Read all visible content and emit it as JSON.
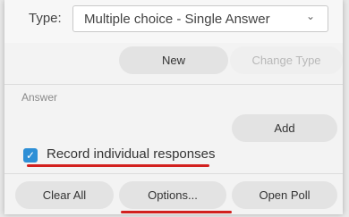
{
  "type_row": {
    "label": "Type:",
    "selected": "Multiple choice - Single Answer"
  },
  "buttons": {
    "new": "New",
    "change_type": "Change Type",
    "add": "Add",
    "clear_all": "Clear All",
    "options": "Options...",
    "open_poll": "Open Poll"
  },
  "answer_section": {
    "label": "Answer"
  },
  "record_individual": {
    "label": "Record individual responses",
    "checked": true
  },
  "colors": {
    "checkbox": "#2d8fd6",
    "highlight": "#d2201e"
  },
  "icons": {
    "select": "chevron-down-icon",
    "checkbox": "checkmark-icon"
  }
}
